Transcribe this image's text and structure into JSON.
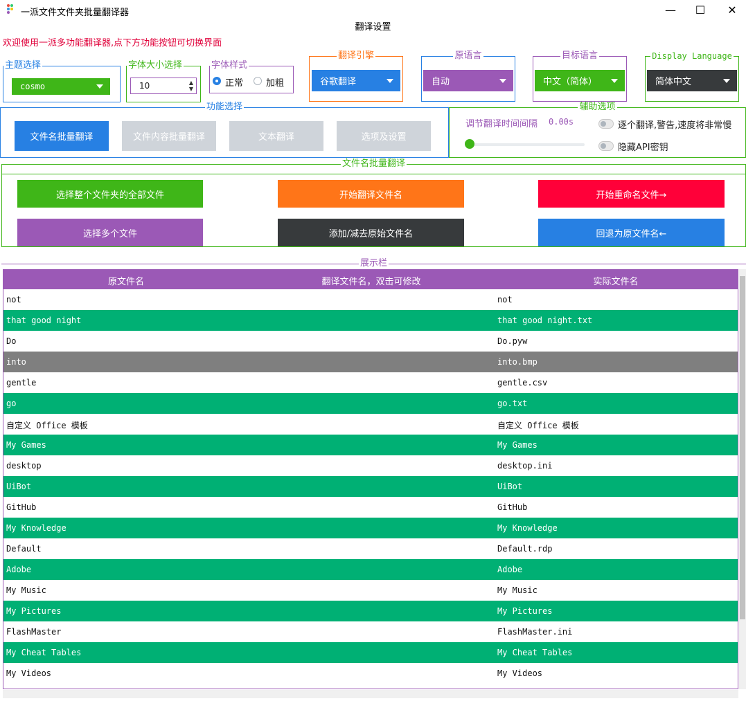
{
  "window": {
    "title": "一派文件文件夹批量翻译器",
    "subtitle": "翻译设置",
    "minimize": "—",
    "maximize": "☐",
    "close": "✕"
  },
  "welcome": "欢迎使用一派多功能翻译器,点下方功能按钮可切换界面",
  "theme": {
    "legend": "主题选择",
    "value": "cosmo",
    "color": "#3fb618",
    "border": "#2780e3"
  },
  "font_size": {
    "legend": "字体大小选择",
    "value": "10",
    "color": "#3fb618"
  },
  "font_style": {
    "legend": "字体样式",
    "normal": "正常",
    "bold": "加粗",
    "selected": "normal",
    "color": "#9b59b6"
  },
  "engine": {
    "legend": "翻译引擎",
    "value": "谷歌翻译",
    "color": "#ff7518",
    "combo": "#2780e3"
  },
  "source_lang": {
    "legend": "原语言",
    "value": "自动",
    "color": "#2780e3",
    "combo": "#9b59b6"
  },
  "target_lang": {
    "legend": "目标语言",
    "value": "中文（简体）",
    "color": "#9b59b6",
    "combo": "#3fb618"
  },
  "display_lang": {
    "legend": "Display Language",
    "value": "简体中文",
    "color": "#3fb618",
    "combo": "#373a3c"
  },
  "functions": {
    "legend": "功能选择",
    "buttons": [
      {
        "label": "文件名批量翻译",
        "active": true
      },
      {
        "label": "文件内容批量翻译",
        "active": false
      },
      {
        "label": "文本翻译",
        "active": false
      },
      {
        "label": "选项及设置",
        "active": false
      }
    ]
  },
  "aux": {
    "legend": "辅助选项",
    "interval_label": "调节翻译时间间隔",
    "interval_value": "0.00s",
    "slider_level": 0,
    "toggle1": "逐个翻译,警告,速度将非常慢",
    "toggle2": "隐藏API密钥"
  },
  "batch": {
    "legend": "文件名批量翻译",
    "select_all": "选择整个文件夹的全部文件",
    "start_translate": "开始翻译文件名",
    "start_rename": "开始重命名文件→",
    "select_multi": "选择多个文件",
    "add_remove": "添加/减去原始文件名",
    "revert": "回退为原文件名←"
  },
  "display": {
    "legend": "展示栏",
    "headers": [
      "原文件名",
      "翻译文件名，双击可修改",
      "实际文件名"
    ],
    "rows": [
      {
        "orig": "not",
        "trans": "",
        "actual": "not",
        "style": "white"
      },
      {
        "orig": "that good night",
        "trans": "",
        "actual": "that good night.txt",
        "style": "green"
      },
      {
        "orig": "Do",
        "trans": "",
        "actual": "Do.pyw",
        "style": "white"
      },
      {
        "orig": "into",
        "trans": "",
        "actual": "into.bmp",
        "style": "gray"
      },
      {
        "orig": "gentle",
        "trans": "",
        "actual": "gentle.csv",
        "style": "white"
      },
      {
        "orig": "go",
        "trans": "",
        "actual": "go.txt",
        "style": "green"
      },
      {
        "orig": "自定义 Office 模板",
        "trans": "",
        "actual": "自定义 Office 模板",
        "style": "white"
      },
      {
        "orig": "My Games",
        "trans": "",
        "actual": "My Games",
        "style": "green"
      },
      {
        "orig": "desktop",
        "trans": "",
        "actual": "desktop.ini",
        "style": "white"
      },
      {
        "orig": "UiBot",
        "trans": "",
        "actual": "UiBot",
        "style": "green"
      },
      {
        "orig": "GitHub",
        "trans": "",
        "actual": "GitHub",
        "style": "white"
      },
      {
        "orig": "My Knowledge",
        "trans": "",
        "actual": "My Knowledge",
        "style": "green"
      },
      {
        "orig": "Default",
        "trans": "",
        "actual": "Default.rdp",
        "style": "white"
      },
      {
        "orig": "Adobe",
        "trans": "",
        "actual": "Adobe",
        "style": "green"
      },
      {
        "orig": "My Music",
        "trans": "",
        "actual": "My Music",
        "style": "white"
      },
      {
        "orig": "My Pictures",
        "trans": "",
        "actual": "My Pictures",
        "style": "green"
      },
      {
        "orig": "FlashMaster",
        "trans": "",
        "actual": "FlashMaster.ini",
        "style": "white"
      },
      {
        "orig": "My Cheat Tables",
        "trans": "",
        "actual": "My Cheat Tables",
        "style": "green"
      },
      {
        "orig": "My Videos",
        "trans": "",
        "actual": "My Videos",
        "style": "white"
      }
    ]
  },
  "colors": {
    "primary": "#2780e3",
    "success": "#3fb618",
    "warning": "#ff7518",
    "danger": "#ff0039",
    "info": "#9b59b6",
    "dark": "#373a3c",
    "light": "#cfd4da",
    "row_green": "#00b074",
    "row_gray": "#7f7f7f"
  }
}
